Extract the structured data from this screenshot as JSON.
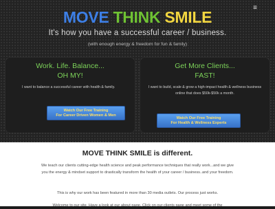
{
  "header": {
    "menu_icon": "≡",
    "brand": {
      "word1": "MOVE",
      "word2": "THINK",
      "word3": "SMILE"
    },
    "tagline": "It's how you have a successful career / business.",
    "subtagline": "(with enough energy & freedom for fun & family)"
  },
  "cards": {
    "left": {
      "title_line1": "Work. Life. Balance...",
      "title_line2": "OH MY!",
      "text": "I want to balance a successful career with health & family.",
      "cta_line1": "Watch Our Free Training",
      "cta_line2": "For Career Driven Women & Men"
    },
    "right": {
      "title_line1": "Get More Clients...",
      "title_line2": "FAST!",
      "text": "I want to build, scale & grow a high-impact health & wellness business online that does $50k-$50k a month.",
      "cta_line1": "Watch Our Free Training",
      "cta_line2": "For Health & Wellness Experts"
    }
  },
  "about": {
    "title": "MOVE THINK SMILE is different.",
    "para1": "We teach our clients cutting-edge health science and peak performance techniques that really work...and we give you the energy & mindset support to drastically transform the health of your career / business..and your freedom.",
    "para2": "This is why our work has been featured in more than 30 media outlets. Our process just works.",
    "para3": "Welcome to our site. Have a look at our about page. Click on our clients page and meet some of the"
  },
  "colors": {
    "brand_blue": "#3d7fe6",
    "brand_green": "#6fc233",
    "brand_yellow": "#f2d640",
    "card_title_green": "#7dd35a",
    "cta_blue": "#4a8ae0",
    "cta_text_yellow": "#ffe066"
  }
}
